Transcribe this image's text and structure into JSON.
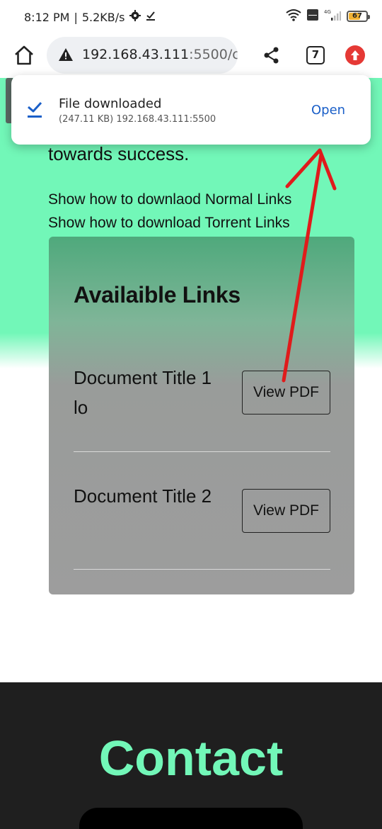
{
  "status_bar": {
    "time": "8:12 PM",
    "separator": "|",
    "speed": "5.2KB/s",
    "battery": "67",
    "network": "4G"
  },
  "browser": {
    "url_host": "192.168.43.111",
    "url_rest": ":5500/c",
    "tab_count": "7"
  },
  "toast": {
    "title": "File downloaded",
    "subtitle": "(247.11 KB) 192.168.43.111:5500",
    "action": "Open"
  },
  "page": {
    "tagline": "towards success.",
    "howto_normal": "Show how to downlaod Normal Links",
    "howto_torrent": "Show how to download Torrent Links",
    "links_heading": "Availaible Links",
    "documents": [
      {
        "title": "Document Title 1 lo",
        "button": "View PDF"
      },
      {
        "title": "Document Title 2",
        "button": "View PDF"
      }
    ],
    "contact_title": "Contact"
  },
  "colors": {
    "hero_bg": "#72f7b8",
    "accent_link": "#1a5fc8",
    "annotation_arrow": "#e01b1b",
    "contact_bg": "#1f1f1f"
  }
}
